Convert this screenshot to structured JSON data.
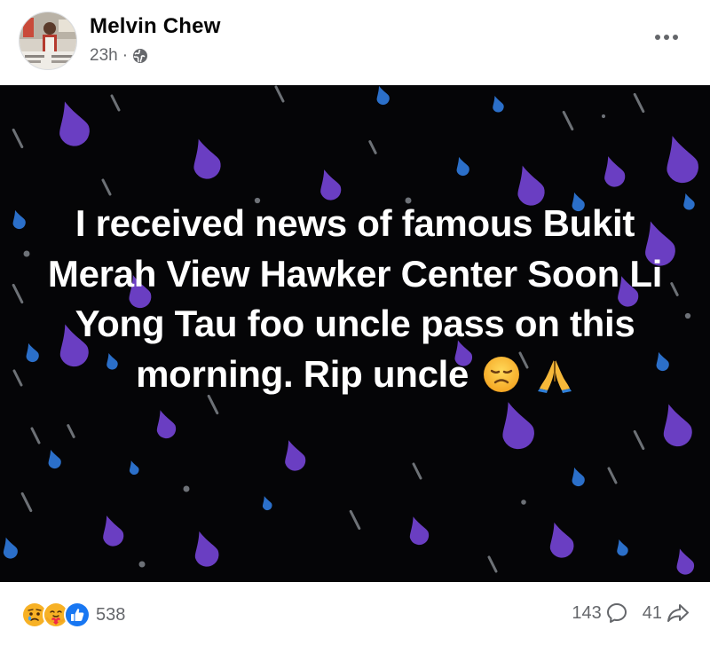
{
  "post": {
    "author": "Melvin Chew",
    "time": "23h",
    "separator": "·",
    "audience_icon": "globe-icon",
    "more_icon": "more-options-icon",
    "text": "I received news of famous Bukit Merah View Hawker Center Soon Li Yong Tau foo uncle pass on this morning. Rip uncle",
    "text_emojis": [
      "😞",
      "🙏"
    ],
    "background_color": "#050507",
    "drop_colors": [
      "#6a3ec2",
      "#2b6fc9",
      "#9aa0a6"
    ]
  },
  "footer": {
    "reaction_icons": [
      "sad-reaction-icon",
      "care-reaction-icon",
      "like-reaction-icon"
    ],
    "reaction_count": "538",
    "comment_count": "143",
    "comment_icon": "comment-icon",
    "share_count": "41",
    "share_icon": "share-icon"
  }
}
